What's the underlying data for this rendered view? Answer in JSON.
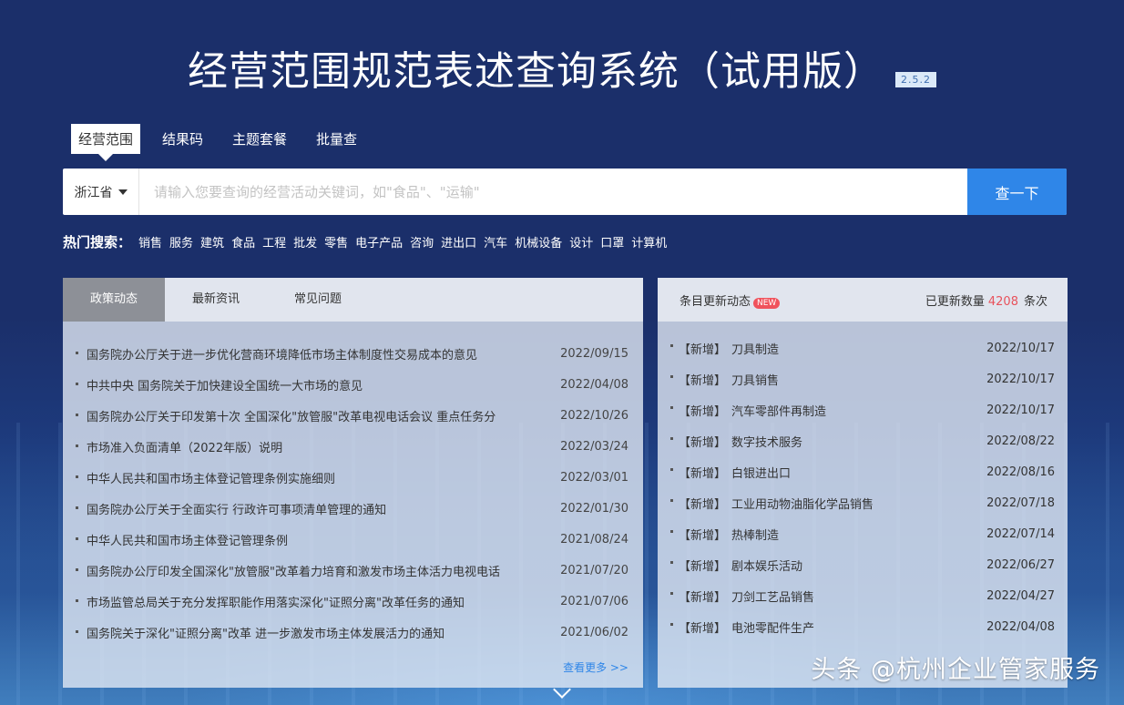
{
  "header": {
    "title": "经营范围规范表述查询系统（试用版）",
    "version": "2.5.2"
  },
  "tabs": [
    {
      "label": "经营范围",
      "active": true
    },
    {
      "label": "结果码",
      "active": false
    },
    {
      "label": "主题套餐",
      "active": false
    },
    {
      "label": "批量查",
      "active": false
    }
  ],
  "search": {
    "province": "浙江省",
    "placeholder": "请输入您要查询的经营活动关键词，如\"食品\"、\"运输\"",
    "value": "",
    "button_label": "查一下"
  },
  "hot": {
    "label": "热门搜索：",
    "items": [
      "销售",
      "服务",
      "建筑",
      "食品",
      "工程",
      "批发",
      "零售",
      "电子产品",
      "咨询",
      "进出口",
      "汽车",
      "机械设备",
      "设计",
      "口罩",
      "计算机"
    ]
  },
  "left_panel": {
    "tabs": [
      {
        "label": "政策动态",
        "active": true
      },
      {
        "label": "最新资讯",
        "active": false
      },
      {
        "label": "常见问题",
        "active": false
      }
    ],
    "items": [
      {
        "title": "国务院办公厅关于进一步优化营商环境降低市场主体制度性交易成本的意见",
        "date": "2022/09/15"
      },
      {
        "title": "中共中央 国务院关于加快建设全国统一大市场的意见",
        "date": "2022/04/08"
      },
      {
        "title": "国务院办公厅关于印发第十次 全国深化\"放管服\"改革电视电话会议 重点任务分",
        "date": "2022/10/26"
      },
      {
        "title": "市场准入负面清单（2022年版）说明",
        "date": "2022/03/24"
      },
      {
        "title": "中华人民共和国市场主体登记管理条例实施细则",
        "date": "2022/03/01"
      },
      {
        "title": "国务院办公厅关于全面实行 行政许可事项清单管理的通知",
        "date": "2022/01/30"
      },
      {
        "title": "中华人民共和国市场主体登记管理条例",
        "date": "2021/08/24"
      },
      {
        "title": "国务院办公厅印发全国深化\"放管服\"改革着力培育和激发市场主体活力电视电话",
        "date": "2021/07/20"
      },
      {
        "title": "市场监管总局关于充分发挥职能作用落实深化\"证照分离\"改革任务的通知",
        "date": "2021/07/06"
      },
      {
        "title": "国务院关于深化\"证照分离\"改革 进一步激发市场主体发展活力的通知",
        "date": "2021/06/02"
      }
    ],
    "more_label": "查看更多 >>"
  },
  "right_panel": {
    "title": "条目更新动态",
    "new_badge": "NEW",
    "count_label": "已更新数量",
    "count": "4208",
    "count_unit": "条次",
    "items": [
      {
        "tag": "【新增】",
        "name": "刀具制造",
        "date": "2022/10/17"
      },
      {
        "tag": "【新增】",
        "name": "刀具销售",
        "date": "2022/10/17"
      },
      {
        "tag": "【新增】",
        "name": "汽车零部件再制造",
        "date": "2022/10/17"
      },
      {
        "tag": "【新增】",
        "name": "数字技术服务",
        "date": "2022/08/22"
      },
      {
        "tag": "【新增】",
        "name": "白银进出口",
        "date": "2022/08/16"
      },
      {
        "tag": "【新增】",
        "name": "工业用动物油脂化学品销售",
        "date": "2022/07/18"
      },
      {
        "tag": "【新增】",
        "name": "热棒制造",
        "date": "2022/07/14"
      },
      {
        "tag": "【新增】",
        "name": "剧本娱乐活动",
        "date": "2022/06/27"
      },
      {
        "tag": "【新增】",
        "name": "刀剑工艺品销售",
        "date": "2022/04/27"
      },
      {
        "tag": "【新增】",
        "name": "电池零配件生产",
        "date": "2022/04/08"
      }
    ]
  },
  "watermark": "头条 @杭州企业管家服务"
}
